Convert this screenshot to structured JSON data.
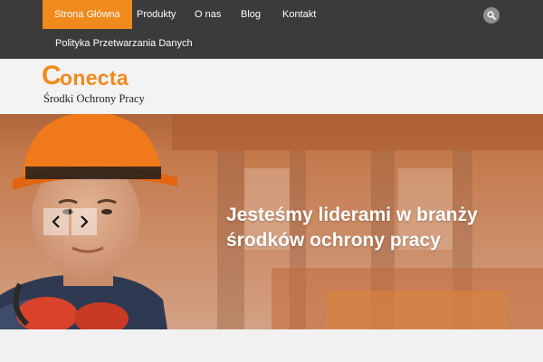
{
  "nav": {
    "items": [
      {
        "label": "Strona Główna",
        "active": true
      },
      {
        "label": "Produkty",
        "active": false
      },
      {
        "label": "O nas",
        "active": false
      },
      {
        "label": "Blog",
        "active": false
      },
      {
        "label": "Kontakt",
        "active": false
      },
      {
        "label": "Polityka Przetwarzania Danych",
        "active": false
      }
    ],
    "search_icon": "search-icon"
  },
  "logo": {
    "word": "onecta",
    "letter": "C",
    "tagline": "Środki Ochrony Pracy"
  },
  "hero": {
    "heading": "Jesteśmy liderami w branży środków ochrony pracy",
    "prev_icon": "chevron-left-icon",
    "next_icon": "chevron-right-icon"
  },
  "colors": {
    "accent": "#f08a1c",
    "nav_background": "#3b3b3b",
    "page_background": "#f1f1f1"
  }
}
